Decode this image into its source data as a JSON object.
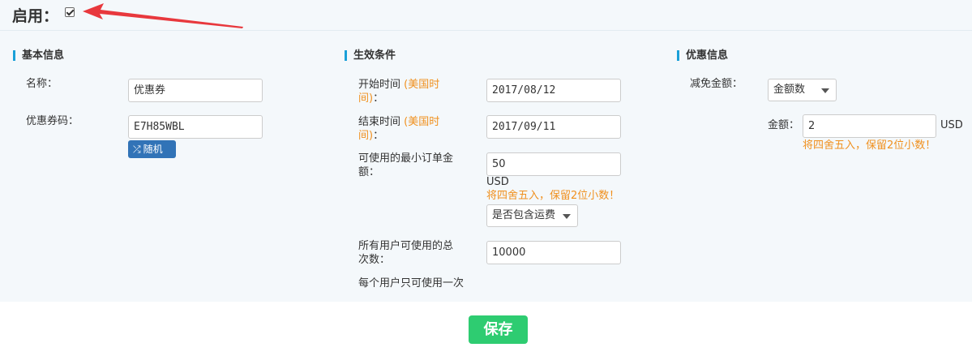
{
  "header": {
    "enable_label": "启用：",
    "enable_checked": true
  },
  "sections": {
    "basic": {
      "title": "基本信息"
    },
    "conditions": {
      "title": "生效条件"
    },
    "discount": {
      "title": "优惠信息"
    }
  },
  "basic": {
    "name_label": "名称：",
    "name_value": "优惠券",
    "code_label": "优惠券码：",
    "code_value": "E7H85WBL",
    "random_label": "随机"
  },
  "conditions": {
    "start_label": "开始时间",
    "start_note_1": "(美国时",
    "start_note_2": "间)",
    "start_colon": "：",
    "start_value": "2017/08/12",
    "end_label": "结束时间",
    "end_note_1": "(美国时",
    "end_note_2": "间)",
    "end_colon": "：",
    "end_value": "2017/09/11",
    "min_order_label_1": "可使用的最小订单金",
    "min_order_label_2": "额：",
    "min_order_value": "50",
    "min_order_unit": "USD",
    "min_order_hint": "将四舍五入，保留2位小数！",
    "shipping_select": "是否包含运费",
    "total_uses_label_1": "所有用户可使用的总",
    "total_uses_label_2": "次数：",
    "total_uses_value": "10000",
    "per_user_text": "每个用户只可使用一次"
  },
  "discount": {
    "reduction_label": "减免金额：",
    "reduction_select": "金额数",
    "amount_label": "金额：",
    "amount_value": "2",
    "amount_unit": "USD",
    "amount_hint": "将四舍五入，保留2位小数！"
  },
  "footer": {
    "save_label": "保存"
  },
  "colors": {
    "accent": "#1aa0d8",
    "hint": "#f0901e",
    "save": "#2ecc71",
    "random": "#3173b7",
    "arrow": "#e8383d"
  }
}
